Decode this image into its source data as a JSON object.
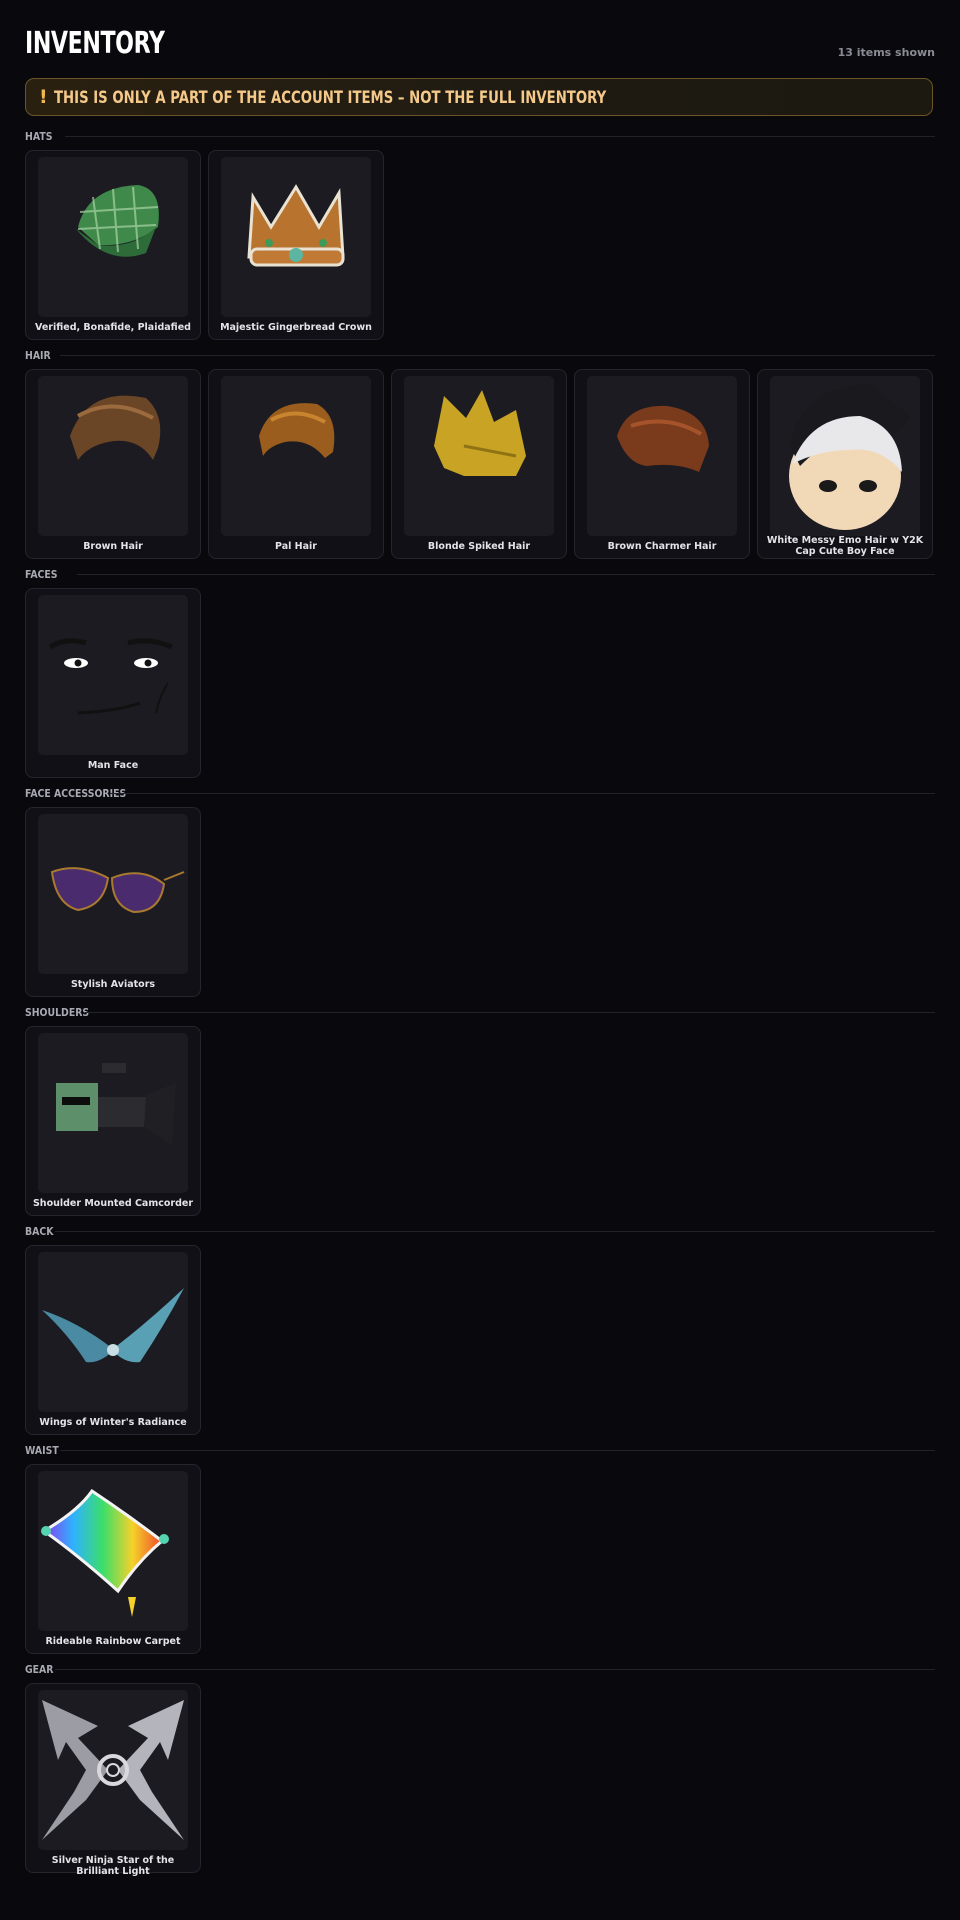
{
  "header": {
    "title": "INVENTORY",
    "count": "13 items shown"
  },
  "banner": {
    "icon": "!",
    "text": "THIS IS ONLY A PART OF THE ACCOUNT ITEMS – NOT THE FULL INVENTORY"
  },
  "sections": [
    {
      "label": "HATS",
      "items": [
        "Verified, Bonafide, Plaidafied",
        "Majestic Gingerbread Crown"
      ]
    },
    {
      "label": "HAIR",
      "items": [
        "Brown Hair",
        "Pal Hair",
        "Blonde Spiked Hair",
        "Brown Charmer Hair",
        "White Messy Emo Hair w Y2K Cap Cute Boy Face"
      ]
    },
    {
      "label": "FACES",
      "items": [
        "Man Face"
      ]
    },
    {
      "label": "FACE ACCESSORIES",
      "items": [
        "Stylish Aviators"
      ]
    },
    {
      "label": "SHOULDERS",
      "items": [
        "Shoulder Mounted Camcorder"
      ]
    },
    {
      "label": "BACK",
      "items": [
        "Wings of Winter's Radiance"
      ]
    },
    {
      "label": "WAIST",
      "items": [
        "Rideable Rainbow Carpet"
      ]
    },
    {
      "label": "GEAR",
      "items": [
        "Silver Ninja Star of the Brilliant Light"
      ]
    }
  ],
  "colors": {
    "background": "#08080d",
    "card": "#101016",
    "banner_accent": "#f0b64f"
  }
}
